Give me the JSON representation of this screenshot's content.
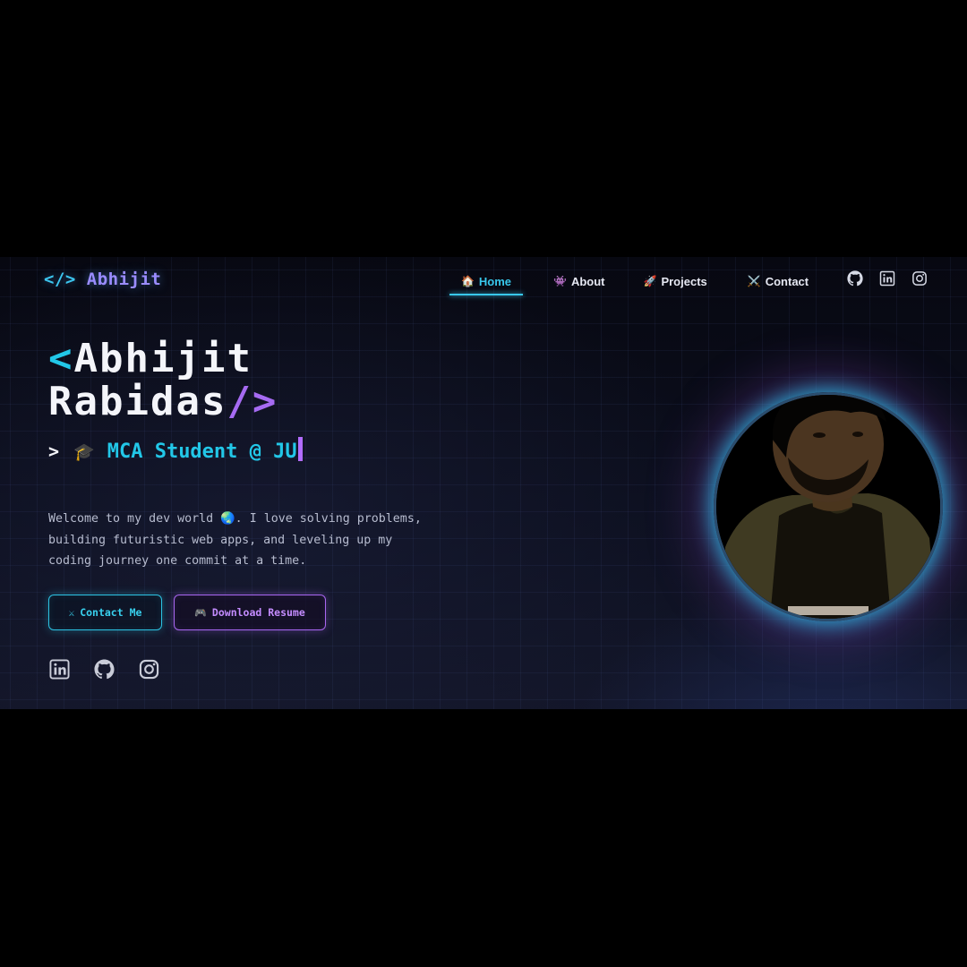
{
  "nav": {
    "logo": {
      "open_tag": "</>",
      "name": "Abhijit"
    },
    "items": [
      {
        "emoji": "🏠",
        "label": "Home",
        "active": true
      },
      {
        "emoji": "👾",
        "label": "About",
        "active": false
      },
      {
        "emoji": "🚀",
        "label": "Projects",
        "active": false
      },
      {
        "emoji": "⚔️",
        "label": "Contact",
        "active": false
      }
    ],
    "social_icons": [
      "github-icon",
      "linkedin-icon",
      "instagram-icon"
    ]
  },
  "hero": {
    "title_open": "<",
    "title_line1": "Abhijit",
    "title_line2": "Rabidas",
    "title_close": "/>",
    "typer": {
      "prompt": ">",
      "emoji": "🎓",
      "text": "MCA Student @ JU"
    },
    "intro": "Welcome to my dev world 🌏. I love solving problems, building futuristic web apps, and leveling up my coding journey one commit at a time.",
    "buttons": {
      "contact": {
        "icon": "⚔",
        "label": "Contact Me"
      },
      "resume": {
        "icon": "🎮",
        "label": "Download Resume"
      }
    },
    "social_icons": [
      "linkedin-icon",
      "github-icon",
      "instagram-icon"
    ]
  },
  "colors": {
    "accent_cyan": "#22c7e8",
    "accent_purple": "#a66bf2",
    "background": "#0c0f1e"
  }
}
